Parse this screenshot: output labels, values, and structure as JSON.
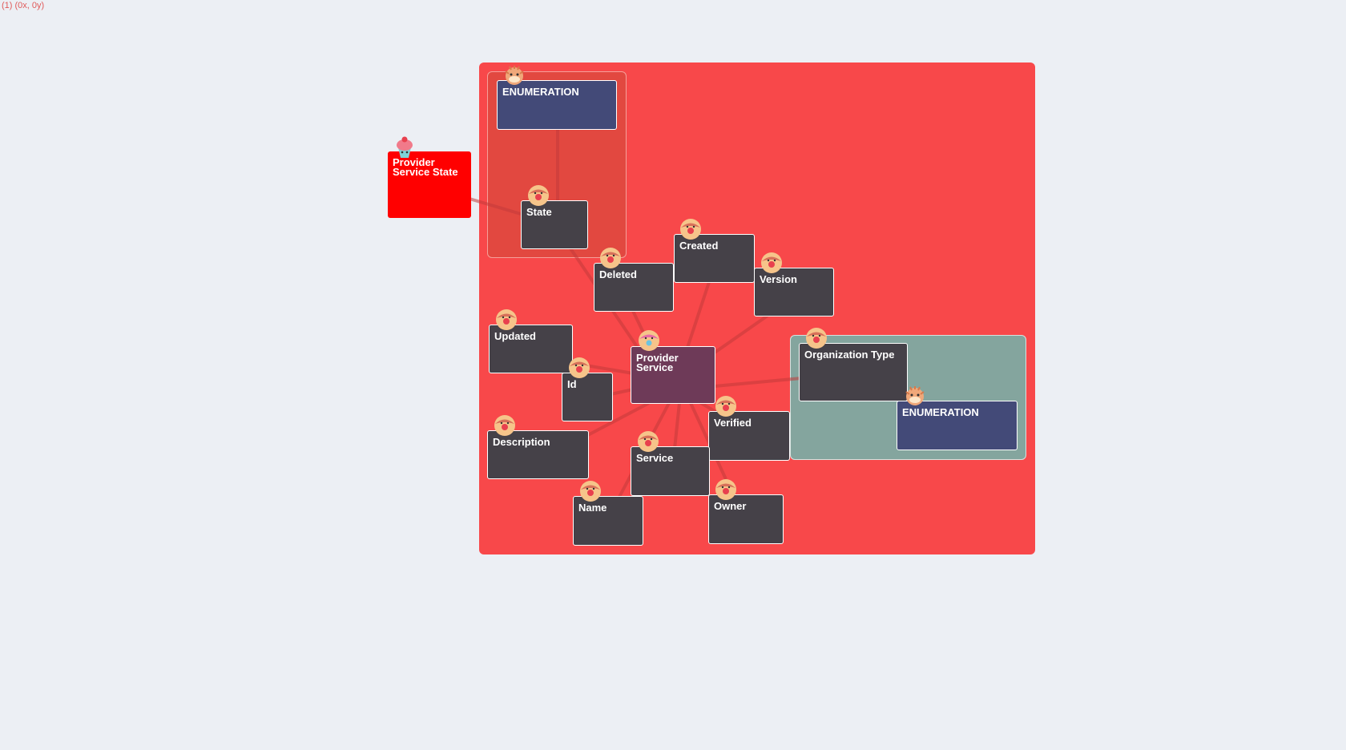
{
  "coord_label": "(1) (0x, 0y)",
  "colors": {
    "background": "#eceff4",
    "outer_container": "#f8484a",
    "state_group": "#e24840",
    "org_group": "#84a59e",
    "node_dark": "#454148",
    "node_enum": "#434a78",
    "node_center": "#6e3a58",
    "node_external": "#ff0000",
    "edge": "#c23a3a"
  },
  "nodes": {
    "provider_service_state": {
      "label": "Provider Service State",
      "icon": "cupcake-icon"
    },
    "enumeration_top": {
      "label": "ENUMERATION",
      "icon": "pufferfish-icon"
    },
    "state": {
      "label": "State",
      "icon": "donut-icon"
    },
    "created": {
      "label": "Created",
      "icon": "donut-icon"
    },
    "deleted": {
      "label": "Deleted",
      "icon": "donut-icon"
    },
    "version": {
      "label": "Version",
      "icon": "donut-icon"
    },
    "updated": {
      "label": "Updated",
      "icon": "donut-icon"
    },
    "provider_service": {
      "label": "Provider Service",
      "icon": "donut-pink-icon"
    },
    "id": {
      "label": "Id",
      "icon": "donut-icon"
    },
    "organization_type": {
      "label": "Organization Type",
      "icon": "donut-icon"
    },
    "enumeration_bottom": {
      "label": "ENUMERATION",
      "icon": "pufferfish-icon"
    },
    "verified": {
      "label": "Verified",
      "icon": "donut-icon"
    },
    "description": {
      "label": "Description",
      "icon": "donut-icon"
    },
    "service": {
      "label": "Service",
      "icon": "donut-icon"
    },
    "name": {
      "label": "Name",
      "icon": "donut-icon"
    },
    "owner": {
      "label": "Owner",
      "icon": "donut-icon"
    }
  }
}
